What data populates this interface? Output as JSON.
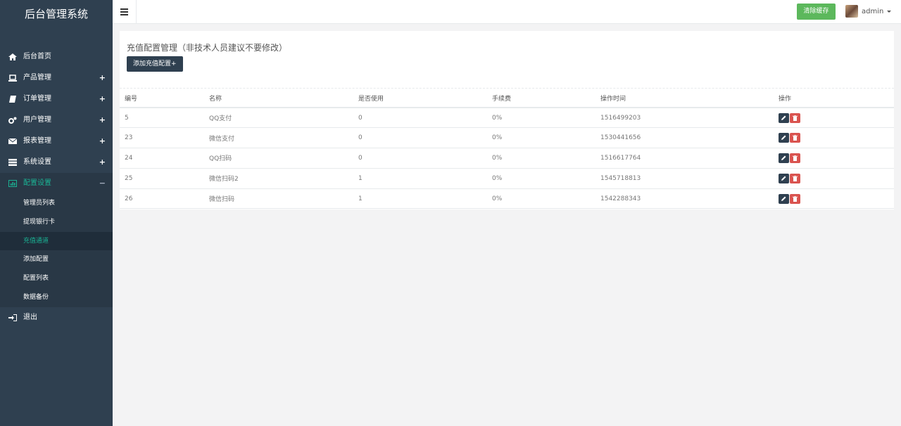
{
  "sidebar": {
    "brand": "后台管理系统",
    "items": [
      {
        "label": "后台首页",
        "icon": "home-icon",
        "expand": ""
      },
      {
        "label": "产品管理",
        "icon": "laptop-icon",
        "expand": "+"
      },
      {
        "label": "订单管理",
        "icon": "book-icon",
        "expand": "+"
      },
      {
        "label": "用户管理",
        "icon": "cogs-icon",
        "expand": "+"
      },
      {
        "label": "报表管理",
        "icon": "envelope-icon",
        "expand": "+"
      },
      {
        "label": "系统设置",
        "icon": "server-icon",
        "expand": "+"
      }
    ],
    "active": {
      "label": "配置设置",
      "icon": "chart-icon",
      "expand": "−"
    },
    "sub_items": [
      "管理员列表",
      "提现银行卡",
      "充值通道",
      "添加配置",
      "配置列表",
      "数据备份"
    ],
    "logout": {
      "label": "退出",
      "icon": "sign-in-icon"
    }
  },
  "topbar": {
    "clear_cache": "清除缓存",
    "username": "admin"
  },
  "panel": {
    "title": "充值配置管理（非技术人员建议不要修改）",
    "add_button": "添加充值配置+"
  },
  "table": {
    "headers": [
      "编号",
      "名称",
      "是否使用",
      "手续费",
      "操作时间",
      "操作"
    ],
    "rows": [
      [
        "5",
        "QQ支付",
        "0",
        "0%",
        "1516499203"
      ],
      [
        "23",
        "微信支付",
        "0",
        "0%",
        "1530441656"
      ],
      [
        "24",
        "QQ扫码",
        "0",
        "0%",
        "1516617764"
      ],
      [
        "25",
        "微信扫码2",
        "1",
        "0%",
        "1545718813"
      ],
      [
        "26",
        "微信扫码",
        "1",
        "0%",
        "1542288343"
      ]
    ]
  },
  "colors": {
    "sidebar_bg": "#2f4050",
    "active_text": "#1ab394",
    "success": "#5cb85c",
    "danger": "#d9534f"
  }
}
